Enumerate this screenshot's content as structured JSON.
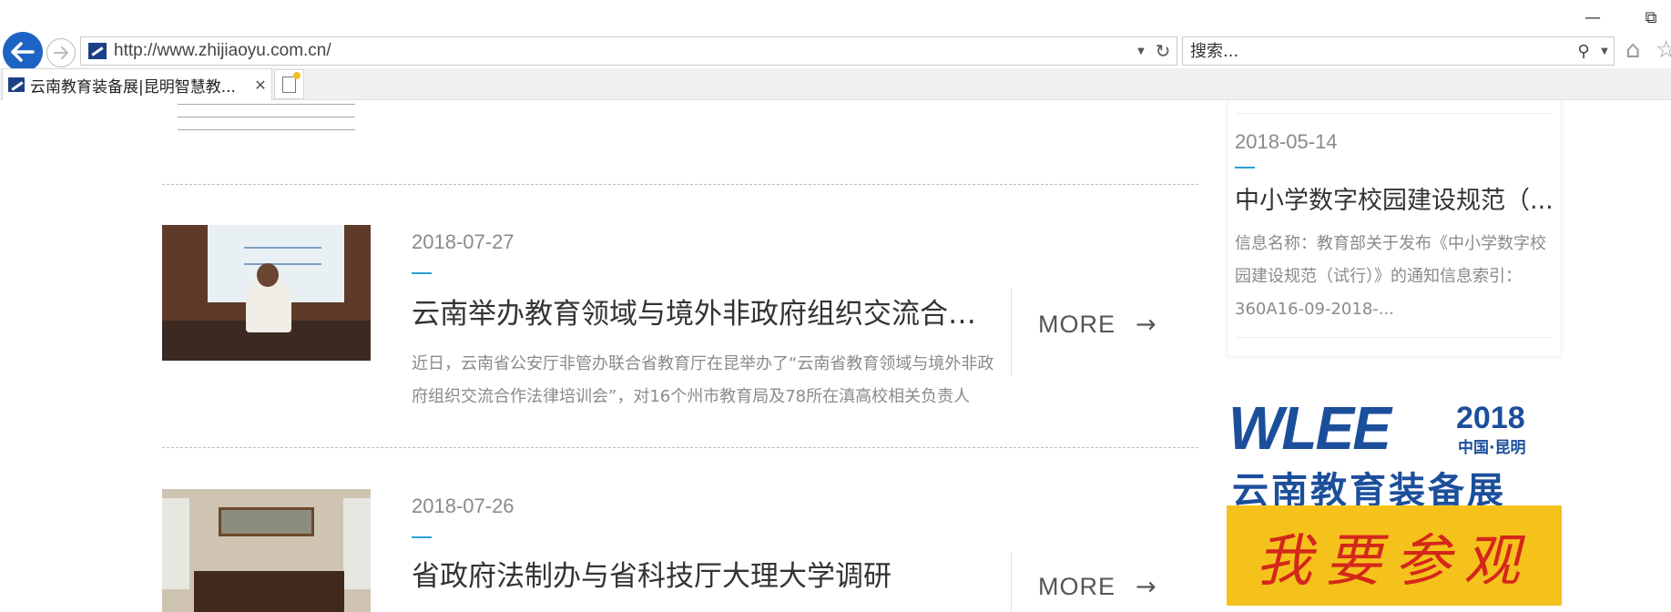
{
  "browser": {
    "url": "http://www.zhijiaoyu.com.cn/",
    "search_placeholder": "搜索...",
    "tab_title": "云南教育装备展|昆明智慧教...",
    "icons": {
      "back": "back-arrow-icon",
      "forward": "forward-arrow-icon",
      "refresh": "refresh-icon",
      "search": "magnifier-icon",
      "home": "home-icon",
      "favorites": "star-icon",
      "minimize": "minimize-icon",
      "restore": "restore-icon",
      "tab_close": "close-icon",
      "new_tab": "new-tab-icon"
    },
    "accent_color": "#1d63c3"
  },
  "news": {
    "items": [
      {
        "date": "2018-07-27",
        "title": "云南举办教育领域与境外非政府组织交流合作...",
        "summary": "近日，云南省公安厅非管办联合省教育厅在昆举办了“云南省教育领域与境外非政府组织交流合作法律培训会”，对16个州市教育局及78所在滇高校相关负责人",
        "more_label": "MORE",
        "more_arrow": "→"
      },
      {
        "date": "2018-07-26",
        "title": "省政府法制办与省科技厅大理大学调研",
        "more_label": "MORE",
        "more_arrow": "→"
      }
    ],
    "accent_color": "#2aa0d8"
  },
  "sidebar": {
    "notice": {
      "date": "2018-05-14",
      "title": "中小学数字校园建设规范（...",
      "summary": "信息名称：教育部关于发布《中小学数字校园建设规范（试行）》的通知信息索引：360A16-09-2018-..."
    },
    "banner": {
      "logo": "WLEE",
      "year": "2018",
      "city": "中国·昆明",
      "name": "云南教育装备展",
      "cta": "我要参观",
      "brand_color": "#1c4f9b",
      "cta_bg": "#f5c21c",
      "cta_color": "#d4271b"
    }
  }
}
